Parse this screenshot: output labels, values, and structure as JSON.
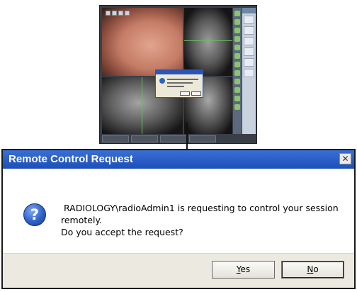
{
  "dialog": {
    "title": "Remote Control Request",
    "close_icon": "close-icon",
    "message_icon": "question-icon",
    "message_line1": "RADIOLOGY\\radioAdmin1 is requesting to control your session",
    "message_line2": "remotely.",
    "message_line3": "Do you accept the request?",
    "yes_label": "Yes",
    "no_label": "No"
  },
  "colors": {
    "titlebar": "#1c4fb8",
    "titlebar_text": "#ffffff",
    "button_area": "#ece9e0",
    "question_icon": "#2d61c9"
  }
}
